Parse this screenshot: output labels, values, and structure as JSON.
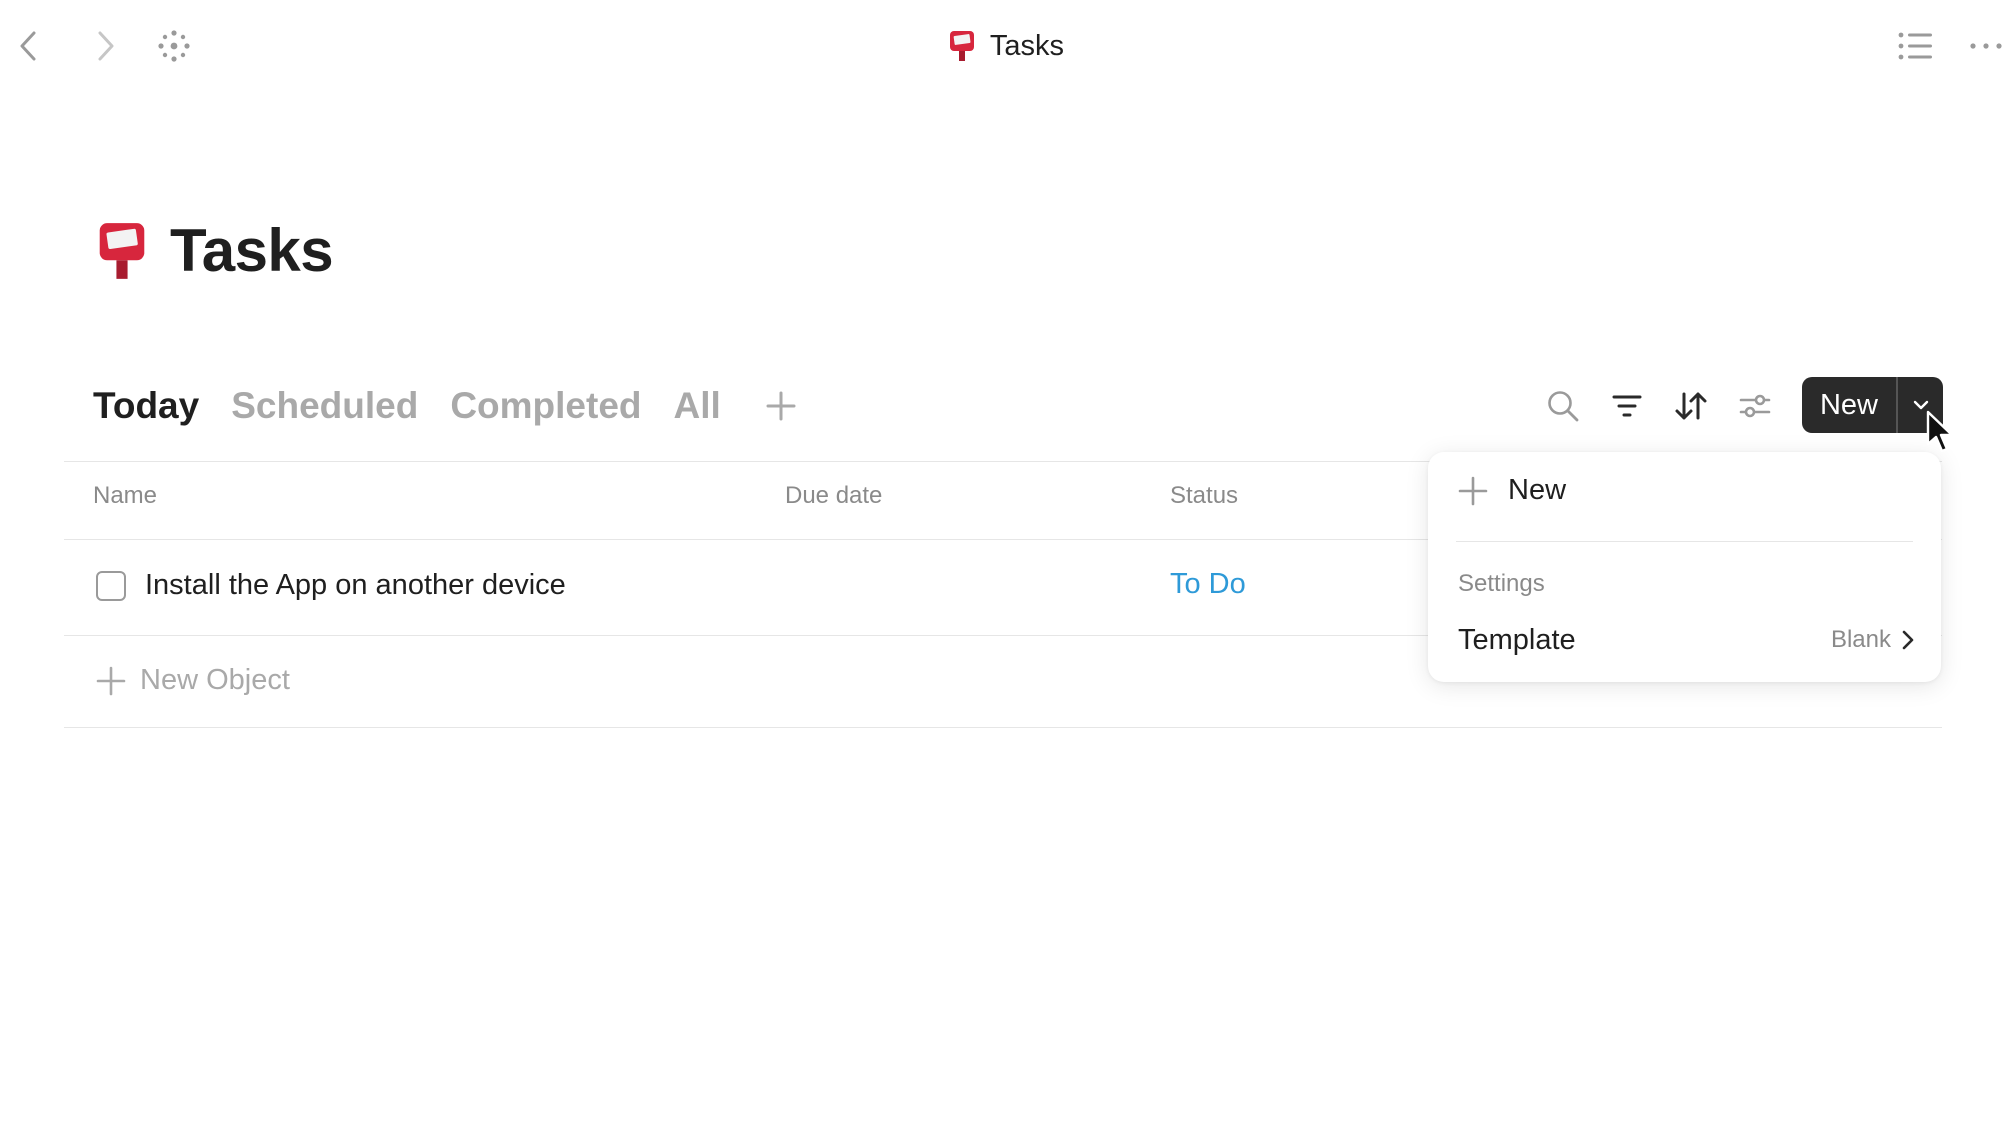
{
  "window": {
    "title": "Tasks"
  },
  "page": {
    "title": "Tasks"
  },
  "tabs": [
    {
      "label": "Today",
      "active": true
    },
    {
      "label": "Scheduled",
      "active": false
    },
    {
      "label": "Completed",
      "active": false
    },
    {
      "label": "All",
      "active": false
    }
  ],
  "toolbar": {
    "new_label": "New"
  },
  "table": {
    "columns": [
      "Name",
      "Due date",
      "Status"
    ],
    "rows": [
      {
        "name": "Install the App on another device",
        "due_date": "",
        "status": "To Do",
        "done": false
      }
    ],
    "new_object_label": "New Object"
  },
  "menu": {
    "new_label": "New",
    "section_label": "Settings",
    "template_label": "Template",
    "template_value": "Blank"
  },
  "colors": {
    "accent_status": "#2e9ad8",
    "button_bg": "#2a2a2a",
    "inactive_tab": "#a9a9a9",
    "mailbox_red": "#d7263d"
  },
  "icons": {
    "page": "postbox-icon",
    "nav_back": "chevron-left-icon",
    "nav_forward": "chevron-right-icon",
    "graph": "graph-dots-icon",
    "list": "list-icon",
    "more": "more-dots-icon"
  }
}
